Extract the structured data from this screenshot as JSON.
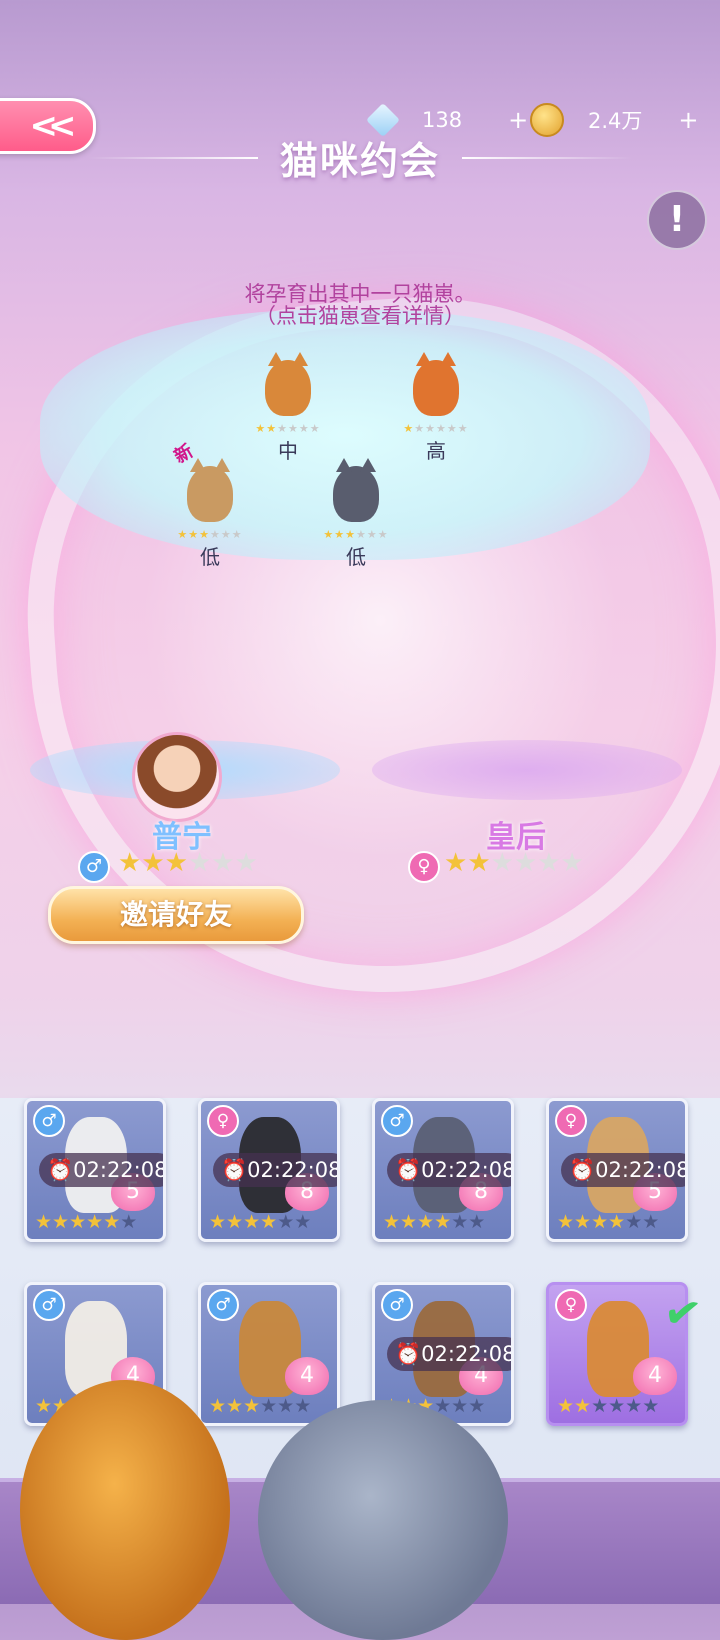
{
  "currency": {
    "diamonds": "138",
    "diamonds_plus": "+",
    "coins": "2.4万",
    "coins_plus": "+"
  },
  "title": "猫咪约会",
  "info_label": "!",
  "hint": {
    "line1": "将孕育出其中一只猫崽。",
    "line2": "（点击猫崽查看详情）"
  },
  "new_tag": "新",
  "kittens": [
    {
      "level": "中",
      "stars": 2,
      "max_stars": 6,
      "color": "#d9883a"
    },
    {
      "level": "高",
      "stars": 1,
      "max_stars": 6,
      "color": "#e0742f"
    },
    {
      "level": "低",
      "stars": 3,
      "max_stars": 6,
      "color": "#c99a62"
    },
    {
      "level": "低",
      "stars": 3,
      "max_stars": 6,
      "color": "#595d6e"
    }
  ],
  "parents": {
    "left": {
      "name": "普宁",
      "gender": "♂",
      "stars": 3,
      "max_stars": 6
    },
    "right": {
      "name": "皇后",
      "gender": "♀",
      "stars": 2,
      "max_stars": 6
    }
  },
  "invite_label": "邀请好友",
  "cards": [
    {
      "gender": "♂",
      "timer": "02:22:08",
      "badge": "5",
      "stars": 5,
      "cat_color": "#f0f0f0"
    },
    {
      "gender": "♀",
      "timer": "02:22:08",
      "badge": "8",
      "stars": 4,
      "cat_color": "#2a2a2e"
    },
    {
      "gender": "♂",
      "timer": "02:22:08",
      "badge": "8",
      "stars": 4,
      "cat_color": "#5a5f74"
    },
    {
      "gender": "♀",
      "timer": "02:22:08",
      "badge": "5",
      "stars": 4,
      "cat_color": "#d7a564"
    },
    {
      "gender": "♂",
      "timer": "",
      "badge": "4",
      "stars": 2,
      "cat_color": "#f1ede6"
    },
    {
      "gender": "♂",
      "timer": "",
      "badge": "4",
      "stars": 3,
      "cat_color": "#c8883c"
    },
    {
      "gender": "♂",
      "timer": "02:22:08",
      "badge": "4",
      "stars": 3,
      "cat_color": "#9a6a3e"
    },
    {
      "gender": "♀",
      "timer": "",
      "badge": "4",
      "stars": 2,
      "cat_color": "#d98a38",
      "selected": true
    }
  ],
  "card_max_stars": 6,
  "star_glyph": "★"
}
